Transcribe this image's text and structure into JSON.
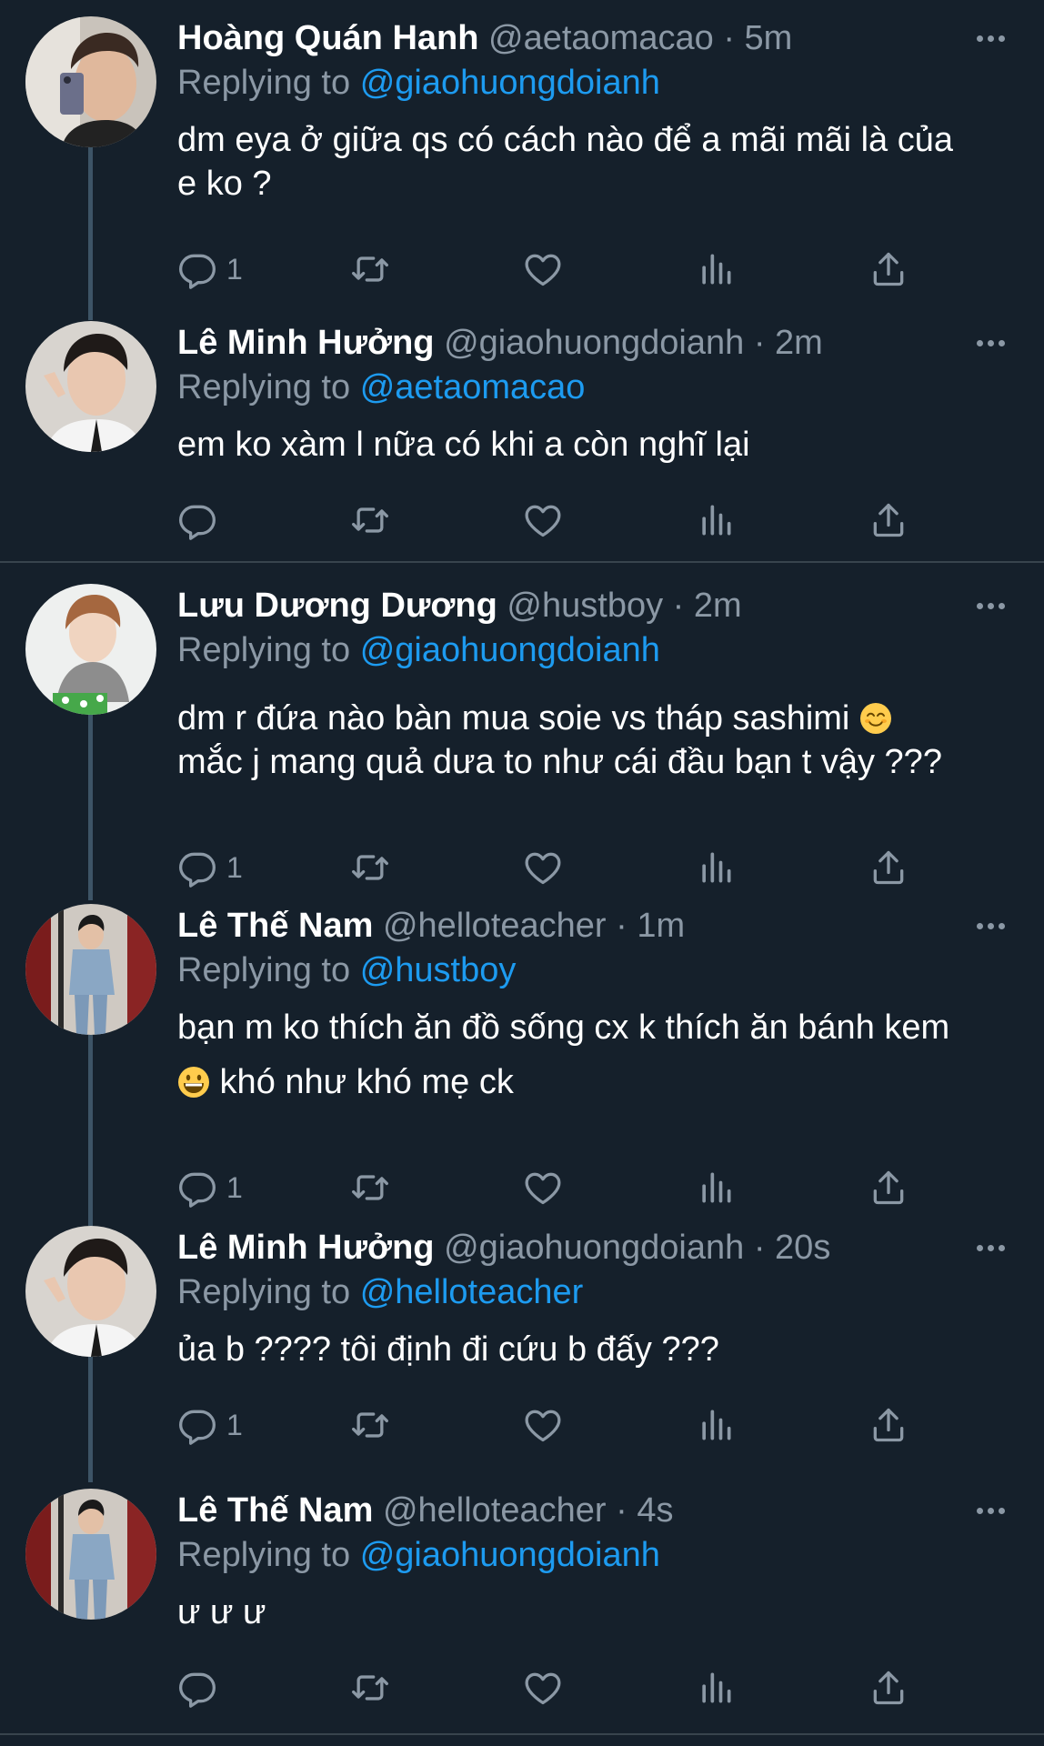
{
  "labels": {
    "replying_prefix": "Replying to"
  },
  "colors": {
    "background": "#15202b",
    "text": "#ffffff",
    "muted": "#8b98a5",
    "mention": "#1d9bf0",
    "divider": "#38444d"
  },
  "tweets": [
    {
      "display_name": "Hoàng Quán Hanh",
      "handle": "@aetaomacao",
      "time": "5m",
      "replying_to": "@giaohuongdoianh",
      "text": "dm eya ở giữa qs có cách nào để a mãi mãi là của\ne ko ?",
      "reply_count": "1"
    },
    {
      "display_name": "Lê Minh Hưởng",
      "handle": "@giaohuongdoianh",
      "time": "2m",
      "replying_to": "@aetaomacao",
      "text": "em ko xàm l nữa có khi a còn nghĩ lại",
      "reply_count": ""
    },
    {
      "display_name": "Lưu Dương Dương",
      "handle": "@hustboy",
      "time": "2m",
      "replying_to": "@giaohuongdoianh",
      "text_a": "dm r đứa nào bàn mua soie vs tháp sashimi ",
      "text_b": "\nmắc j mang quả dưa to như cái đầu bạn t vậy ???",
      "reply_count": "1"
    },
    {
      "display_name": "Lê Thế Nam",
      "handle": "@helloteacher",
      "time": "1m",
      "replying_to": "@hustboy",
      "text_a": "bạn m ko thích ăn đồ sống cx k thích ăn bánh kem\n",
      "text_b": " khó như khó mẹ ck",
      "reply_count": "1"
    },
    {
      "display_name": "Lê Minh Hưởng",
      "handle": "@giaohuongdoianh",
      "time": "20s",
      "replying_to": "@helloteacher",
      "text": "ủa b ???? tôi định đi cứu b đấy ???",
      "reply_count": "1"
    },
    {
      "display_name": "Lê Thế Nam",
      "handle": "@helloteacher",
      "time": "4s",
      "replying_to": "@giaohuongdoianh",
      "text": "ư ư ư",
      "reply_count": ""
    }
  ],
  "icons": {
    "reply": "reply-icon",
    "retweet": "retweet-icon",
    "like": "heart-icon",
    "views": "views-icon",
    "share": "share-icon",
    "more": "more-icon",
    "emoji_1": "smiling-face-emoji",
    "emoji_2": "grinning-face-emoji"
  }
}
